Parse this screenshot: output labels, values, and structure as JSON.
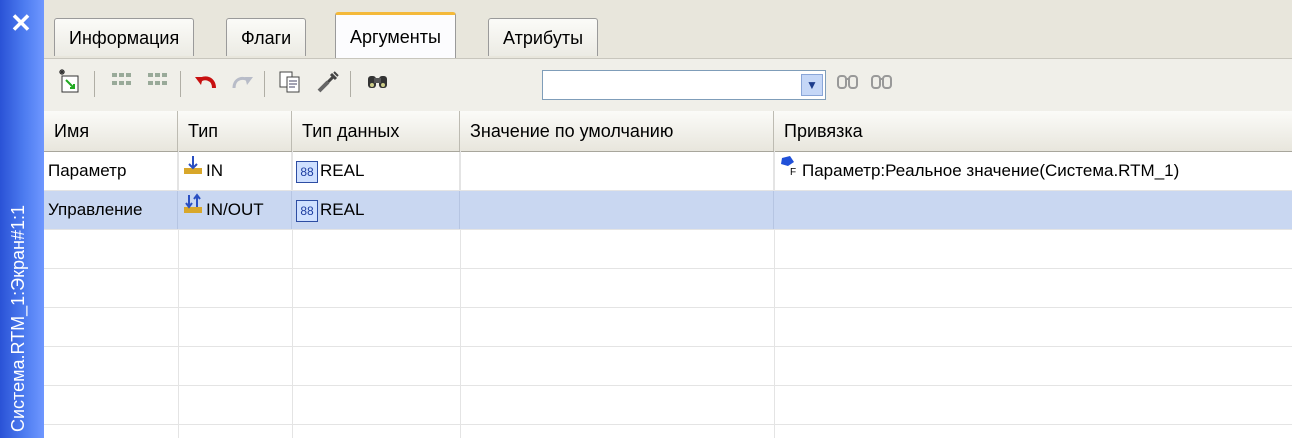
{
  "side_panel": {
    "close_glyph": "✕",
    "caption": "Система.RTM_1:Экран#1:1"
  },
  "tabs": [
    {
      "label": "Информация"
    },
    {
      "label": "Флаги"
    },
    {
      "label": "Аргументы",
      "active": true
    },
    {
      "label": "Атрибуты"
    }
  ],
  "toolbar": {
    "icons": [
      "new-argument-icon",
      "grid-icon",
      "grid-icon-2",
      "undo-icon",
      "redo-icon",
      "copy-icon",
      "link-icon",
      "find-icon"
    ],
    "search_value": "",
    "search_placeholder": "",
    "find_next_icon": "find-next-icon",
    "find_prev_icon": "find-prev-icon"
  },
  "table": {
    "columns": [
      "Имя",
      "Тип",
      "Тип данных",
      "Значение по умолчанию",
      "Привязка"
    ],
    "rows": [
      {
        "name": "Параметр",
        "type": "IN",
        "data_type": "REAL",
        "default": "",
        "binding": "Параметр:Реальное значение(Система.RTM_1)",
        "selected": false
      },
      {
        "name": "Управление",
        "type": "IN/OUT",
        "data_type": "REAL",
        "default": "",
        "binding": "",
        "selected": true
      }
    ]
  },
  "colors": {
    "accent_tab": "#f4b93a",
    "selection": "#c9d7f1",
    "side_panel": "#3e6ae6"
  }
}
